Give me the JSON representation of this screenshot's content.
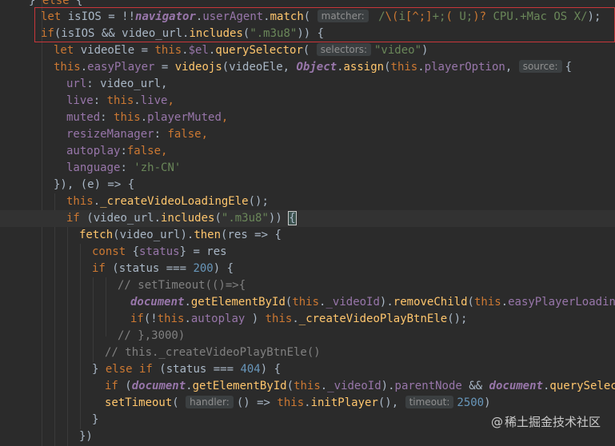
{
  "lines": [
    {
      "seg": [
        {
          "t": "} ",
          "c": ""
        },
        {
          "t": "else",
          "c": "kw"
        },
        {
          "t": " {",
          "c": ""
        }
      ]
    },
    {
      "seg": [
        {
          "t": "let ",
          "c": "kw"
        },
        {
          "t": "isIOS = !!",
          "c": ""
        },
        {
          "t": "navigator",
          "c": "glob"
        },
        {
          "t": ".",
          "c": ""
        },
        {
          "t": "userAgent",
          "c": "prop"
        },
        {
          "t": ".",
          "c": ""
        },
        {
          "t": "match",
          "c": "fn"
        },
        {
          "t": "( ",
          "c": ""
        },
        {
          "t": "matcher:",
          "c": "hint"
        },
        {
          "t": " /",
          "c": "re"
        },
        {
          "t": "\\(",
          "c": "reb"
        },
        {
          "t": "i",
          "c": "re"
        },
        {
          "t": "[^;]",
          "c": "reb"
        },
        {
          "t": "+;",
          "c": "re"
        },
        {
          "t": "(",
          "c": "reb"
        },
        {
          "t": " U;",
          "c": "re"
        },
        {
          "t": ")?",
          "c": "reb"
        },
        {
          "t": " CPU.+Mac OS X",
          "c": "re"
        },
        {
          "t": "/",
          "c": "re"
        },
        {
          "t": ");",
          "c": ""
        }
      ]
    },
    {
      "seg": [
        {
          "t": "if",
          "c": "kw"
        },
        {
          "t": "(isIOS && video_url.",
          "c": ""
        },
        {
          "t": "includes",
          "c": "fn"
        },
        {
          "t": "(",
          "c": ""
        },
        {
          "t": "\".m3u8\"",
          "c": "str"
        },
        {
          "t": ")) {",
          "c": ""
        }
      ]
    },
    {
      "seg": [
        {
          "t": "let ",
          "c": "kw"
        },
        {
          "t": "videoEle = ",
          "c": ""
        },
        {
          "t": "this",
          "c": "kw"
        },
        {
          "t": ".",
          "c": ""
        },
        {
          "t": "$el",
          "c": "prop"
        },
        {
          "t": ".",
          "c": ""
        },
        {
          "t": "querySelector",
          "c": "fn"
        },
        {
          "t": "( ",
          "c": ""
        },
        {
          "t": "selectors:",
          "c": "hint"
        },
        {
          "t": "\"video\"",
          "c": "str"
        },
        {
          "t": ")",
          "c": ""
        }
      ]
    },
    {
      "seg": [
        {
          "t": "this",
          "c": "kw"
        },
        {
          "t": ".",
          "c": ""
        },
        {
          "t": "easyPlayer",
          "c": "prop"
        },
        {
          "t": " = ",
          "c": ""
        },
        {
          "t": "videojs",
          "c": "fn"
        },
        {
          "t": "(videoEle, ",
          "c": ""
        },
        {
          "t": "Object",
          "c": "obj"
        },
        {
          "t": ".",
          "c": ""
        },
        {
          "t": "assign",
          "c": "fn"
        },
        {
          "t": "(",
          "c": ""
        },
        {
          "t": "this",
          "c": "kw"
        },
        {
          "t": ".",
          "c": ""
        },
        {
          "t": "playerOption",
          "c": "prop"
        },
        {
          "t": ", ",
          "c": ""
        },
        {
          "t": "source:",
          "c": "hint"
        },
        {
          "t": "{",
          "c": ""
        }
      ]
    },
    {
      "seg": [
        {
          "t": "url",
          "c": "prop"
        },
        {
          "t": ": video_url,",
          "c": ""
        }
      ]
    },
    {
      "seg": [
        {
          "t": "live",
          "c": "prop"
        },
        {
          "t": ": ",
          "c": ""
        },
        {
          "t": "this",
          "c": "kw"
        },
        {
          "t": ".",
          "c": ""
        },
        {
          "t": "live",
          "c": "prop"
        },
        {
          "t": ",",
          "c": "kw"
        }
      ]
    },
    {
      "seg": [
        {
          "t": "muted",
          "c": "prop"
        },
        {
          "t": ": ",
          "c": ""
        },
        {
          "t": "this",
          "c": "kw"
        },
        {
          "t": ".",
          "c": ""
        },
        {
          "t": "playerMuted",
          "c": "prop"
        },
        {
          "t": ",",
          "c": "kw"
        }
      ]
    },
    {
      "seg": [
        {
          "t": "resizeManager",
          "c": "prop"
        },
        {
          "t": ": ",
          "c": ""
        },
        {
          "t": "false",
          "c": "kw"
        },
        {
          "t": ",",
          "c": "kw"
        }
      ]
    },
    {
      "seg": [
        {
          "t": "autoplay",
          "c": "prop"
        },
        {
          "t": ":",
          "c": ""
        },
        {
          "t": "false",
          "c": "kw"
        },
        {
          "t": ",",
          "c": "kw"
        }
      ]
    },
    {
      "seg": [
        {
          "t": "language",
          "c": "prop"
        },
        {
          "t": ": ",
          "c": ""
        },
        {
          "t": "'zh-CN'",
          "c": "str"
        }
      ]
    },
    {
      "seg": [
        {
          "t": "}), (e) => {",
          "c": ""
        }
      ]
    },
    {
      "seg": [
        {
          "t": "this",
          "c": "kw"
        },
        {
          "t": ".",
          "c": ""
        },
        {
          "t": "_createVideoLoadingEle",
          "c": "fn"
        },
        {
          "t": "();",
          "c": ""
        }
      ]
    },
    {
      "seg": [
        {
          "t": "if ",
          "c": "kw"
        },
        {
          "t": "(video_url.",
          "c": ""
        },
        {
          "t": "includes",
          "c": "fn"
        },
        {
          "t": "(",
          "c": ""
        },
        {
          "t": "\".m3u8\"",
          "c": "str"
        },
        {
          "t": ")) ",
          "c": ""
        },
        {
          "t": "{",
          "c": "brace-match"
        }
      ]
    },
    {
      "seg": [
        {
          "t": "fetch",
          "c": "fn"
        },
        {
          "t": "(video_url).",
          "c": ""
        },
        {
          "t": "then",
          "c": "fn"
        },
        {
          "t": "(res => {",
          "c": ""
        }
      ]
    },
    {
      "seg": [
        {
          "t": "const ",
          "c": "kw"
        },
        {
          "t": "{",
          "c": ""
        },
        {
          "t": "status",
          "c": "prop"
        },
        {
          "t": "} = res",
          "c": ""
        }
      ]
    },
    {
      "seg": [
        {
          "t": "if ",
          "c": "kw"
        },
        {
          "t": "(status === ",
          "c": ""
        },
        {
          "t": "200",
          "c": "num"
        },
        {
          "t": ") {",
          "c": ""
        }
      ]
    },
    {
      "seg": [
        {
          "t": "// setTimeout(()=>{",
          "c": "cmt"
        }
      ]
    },
    {
      "seg": [
        {
          "t": "document",
          "c": "glob"
        },
        {
          "t": ".",
          "c": ""
        },
        {
          "t": "getElementById",
          "c": "fn"
        },
        {
          "t": "(",
          "c": ""
        },
        {
          "t": "this",
          "c": "kw"
        },
        {
          "t": ".",
          "c": ""
        },
        {
          "t": "_videoId",
          "c": "prop"
        },
        {
          "t": ").",
          "c": ""
        },
        {
          "t": "removeChild",
          "c": "fn"
        },
        {
          "t": "(",
          "c": ""
        },
        {
          "t": "this",
          "c": "kw"
        },
        {
          "t": ".",
          "c": ""
        },
        {
          "t": "easyPlayerLoadingEle",
          "c": "prop"
        }
      ]
    },
    {
      "seg": [
        {
          "t": "if",
          "c": "kw"
        },
        {
          "t": "(!",
          "c": ""
        },
        {
          "t": "this",
          "c": "kw"
        },
        {
          "t": ".",
          "c": ""
        },
        {
          "t": "autoplay",
          "c": "prop"
        },
        {
          "t": " ) ",
          "c": ""
        },
        {
          "t": "this",
          "c": "kw"
        },
        {
          "t": ".",
          "c": ""
        },
        {
          "t": "_createVideoPlayBtnEle",
          "c": "fn"
        },
        {
          "t": "();",
          "c": ""
        }
      ]
    },
    {
      "seg": [
        {
          "t": "// },3000)",
          "c": "cmt"
        }
      ]
    },
    {
      "seg": [
        {
          "t": "// this._createVideoPlayBtnEle()",
          "c": "cmt"
        }
      ]
    },
    {
      "seg": [
        {
          "t": "} ",
          "c": ""
        },
        {
          "t": "else if ",
          "c": "kw"
        },
        {
          "t": "(status === ",
          "c": ""
        },
        {
          "t": "404",
          "c": "num"
        },
        {
          "t": ") {",
          "c": ""
        }
      ]
    },
    {
      "seg": [
        {
          "t": "if ",
          "c": "kw"
        },
        {
          "t": "(",
          "c": ""
        },
        {
          "t": "document",
          "c": "glob"
        },
        {
          "t": ".",
          "c": ""
        },
        {
          "t": "getElementById",
          "c": "fn"
        },
        {
          "t": "(",
          "c": ""
        },
        {
          "t": "this",
          "c": "kw"
        },
        {
          "t": ".",
          "c": ""
        },
        {
          "t": "_videoId",
          "c": "prop"
        },
        {
          "t": ").",
          "c": ""
        },
        {
          "t": "parentNode",
          "c": "prop"
        },
        {
          "t": " && ",
          "c": ""
        },
        {
          "t": "document",
          "c": "glob"
        },
        {
          "t": ".",
          "c": ""
        },
        {
          "t": "querySelector",
          "c": "fn"
        },
        {
          "t": "(",
          "c": ""
        }
      ]
    },
    {
      "seg": [
        {
          "t": "setTimeout",
          "c": "fn"
        },
        {
          "t": "( ",
          "c": ""
        },
        {
          "t": "handler:",
          "c": "hint"
        },
        {
          "t": "() => ",
          "c": ""
        },
        {
          "t": "this",
          "c": "kw"
        },
        {
          "t": ".",
          "c": ""
        },
        {
          "t": "initPlayer",
          "c": "fn"
        },
        {
          "t": "(), ",
          "c": ""
        },
        {
          "t": "timeout:",
          "c": "hint"
        },
        {
          "t": "2500",
          "c": "num"
        },
        {
          "t": ")",
          "c": ""
        }
      ]
    },
    {
      "seg": [
        {
          "t": "}",
          "c": ""
        }
      ]
    },
    {
      "seg": [
        {
          "t": "})",
          "c": ""
        }
      ]
    }
  ],
  "watermark": {
    "at": "@",
    "text": "稀土掘金技术社区"
  }
}
